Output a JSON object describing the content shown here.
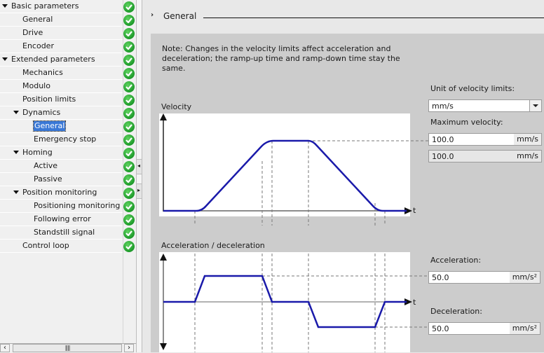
{
  "tree": {
    "items": [
      {
        "label": "Basic parameters",
        "level": 0,
        "expanded": true,
        "selected": false
      },
      {
        "label": "General",
        "level": 1,
        "expanded": null,
        "selected": false
      },
      {
        "label": "Drive",
        "level": 1,
        "expanded": null,
        "selected": false
      },
      {
        "label": "Encoder",
        "level": 1,
        "expanded": null,
        "selected": false
      },
      {
        "label": "Extended parameters",
        "level": 0,
        "expanded": true,
        "selected": false
      },
      {
        "label": "Mechanics",
        "level": 1,
        "expanded": null,
        "selected": false
      },
      {
        "label": "Modulo",
        "level": 1,
        "expanded": null,
        "selected": false
      },
      {
        "label": "Position limits",
        "level": 1,
        "expanded": null,
        "selected": false
      },
      {
        "label": "Dynamics",
        "level": 1,
        "expanded": true,
        "selected": false
      },
      {
        "label": "General",
        "level": 2,
        "expanded": null,
        "selected": true
      },
      {
        "label": "Emergency stop",
        "level": 2,
        "expanded": null,
        "selected": false
      },
      {
        "label": "Homing",
        "level": 1,
        "expanded": true,
        "selected": false
      },
      {
        "label": "Active",
        "level": 2,
        "expanded": null,
        "selected": false
      },
      {
        "label": "Passive",
        "level": 2,
        "expanded": null,
        "selected": false
      },
      {
        "label": "Position monitoring",
        "level": 1,
        "expanded": true,
        "selected": false
      },
      {
        "label": "Positioning monitoring",
        "level": 2,
        "expanded": null,
        "selected": false
      },
      {
        "label": "Following error",
        "level": 2,
        "expanded": null,
        "selected": false
      },
      {
        "label": "Standstill signal",
        "level": 2,
        "expanded": null,
        "selected": false
      },
      {
        "label": "Control loop",
        "level": 1,
        "expanded": null,
        "selected": false
      }
    ],
    "status_icon": "check-circle-icon",
    "status_color": "#2aa838",
    "selection_color": "#3a78d6"
  },
  "scrollbars": {
    "left_arrow": "‹",
    "right_arrow": "›",
    "thumb_grip": "||||",
    "collapse_left": "◂",
    "collapse_right": "▸"
  },
  "section": {
    "chevron": "›",
    "title": "General"
  },
  "note": "Note: Changes in the velocity limits affect acceleration and deceleration; the ramp-up time and ramp-down time stay the same.",
  "velocity_chart": {
    "title": "Velocity",
    "t_label": "t",
    "curve_color": "#1a1aaa"
  },
  "accel_chart": {
    "title": "Acceleration / deceleration",
    "t_label": "t",
    "curve_color": "#1a1aaa"
  },
  "form": {
    "unit_label": "Unit of velocity limits:",
    "unit_value": "mm/s",
    "max_velocity_label": "Maximum velocity:",
    "max_velocity_value": "100.0",
    "max_velocity_unit": "mm/s",
    "max_velocity_readonly_value": "100.0",
    "max_velocity_readonly_unit": "mm/s",
    "acceleration_label": "Acceleration:",
    "acceleration_value": "50.0",
    "acceleration_unit": "mm/s²",
    "deceleration_label": "Deceleration:",
    "deceleration_value": "50.0",
    "deceleration_unit": "mm/s²"
  }
}
